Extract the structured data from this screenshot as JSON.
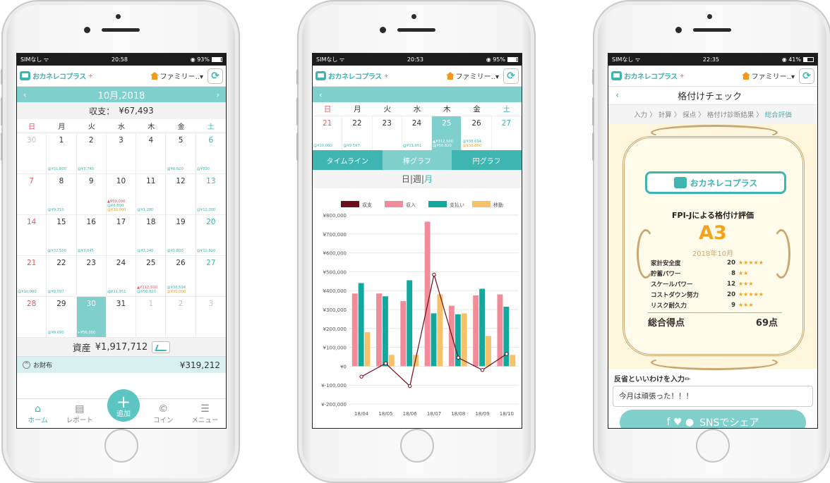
{
  "status": {
    "p1": {
      "carrier": "SIMなし ᯤ",
      "time": "20:58",
      "battery": "◉ 93%",
      "fill": 0.93
    },
    "p2": {
      "carrier": "SIMなし ᯤ",
      "time": "20:53",
      "battery": "◉ 95%",
      "fill": 0.95
    },
    "p3": {
      "carrier": "SIMなし ᯤ",
      "time": "22:35",
      "battery": "◉ 41%",
      "fill": 0.41
    }
  },
  "app": {
    "logo": "おカネレコプラス",
    "logo_sup": "+",
    "family": "ファミリー..▾",
    "refresh": "⟳"
  },
  "p1": {
    "month": "10月,2018",
    "prev": "‹",
    "next": "›",
    "balance_label": "収支：",
    "balance_value": "¥67,493",
    "dow": [
      "日",
      "月",
      "火",
      "水",
      "木",
      "金",
      "土"
    ],
    "days": [
      {
        "d": "30",
        "c": "gray",
        "l": []
      },
      {
        "d": "1",
        "c": "",
        "l": [
          [
            "ub",
            "@¥31,800"
          ]
        ]
      },
      {
        "d": "2",
        "c": "",
        "l": [
          [
            "ub",
            "@¥3,740"
          ]
        ]
      },
      {
        "d": "3",
        "c": "",
        "l": []
      },
      {
        "d": "4",
        "c": "",
        "l": []
      },
      {
        "d": "5",
        "c": "",
        "l": [
          [
            "ub",
            "@¥8,620"
          ]
        ]
      },
      {
        "d": "6",
        "c": "sat",
        "l": [
          [
            "ub",
            "@¥890"
          ]
        ]
      },
      {
        "d": "7",
        "c": "sun",
        "l": []
      },
      {
        "d": "8",
        "c": "",
        "l": [
          [
            "ub",
            "@¥9,710"
          ]
        ]
      },
      {
        "d": "9",
        "c": "",
        "l": []
      },
      {
        "d": "10",
        "c": "",
        "l": [
          [
            "uo",
            "@¥30,000"
          ],
          [
            "ub",
            "@¥6,890"
          ],
          [
            "ur",
            "▲¥69,000"
          ]
        ]
      },
      {
        "d": "11",
        "c": "",
        "l": [
          [
            "ub",
            "@¥1,200"
          ]
        ]
      },
      {
        "d": "12",
        "c": "",
        "l": []
      },
      {
        "d": "13",
        "c": "sat",
        "l": [
          [
            "ub",
            "@¥12,000"
          ]
        ]
      },
      {
        "d": "14",
        "c": "sun",
        "l": []
      },
      {
        "d": "15",
        "c": "",
        "l": [
          [
            "ub",
            "@¥32,500"
          ]
        ]
      },
      {
        "d": "16",
        "c": "",
        "l": [
          [
            "ub",
            "@¥3,045"
          ]
        ]
      },
      {
        "d": "17",
        "c": "",
        "l": []
      },
      {
        "d": "18",
        "c": "",
        "l": [
          [
            "ub",
            "@¥3,240"
          ]
        ]
      },
      {
        "d": "19",
        "c": "",
        "l": [
          [
            "ub",
            "@¥1,800"
          ]
        ]
      },
      {
        "d": "20",
        "c": "sat",
        "l": [
          [
            "ub",
            "@¥12,820"
          ]
        ]
      },
      {
        "d": "21",
        "c": "sun",
        "l": [
          [
            "ub",
            "@¥10,000"
          ]
        ]
      },
      {
        "d": "22",
        "c": "",
        "l": [
          [
            "ub",
            "@¥9,597"
          ]
        ]
      },
      {
        "d": "23",
        "c": "",
        "l": []
      },
      {
        "d": "24",
        "c": "",
        "l": [
          [
            "ub",
            "@¥11,951"
          ]
        ]
      },
      {
        "d": "25",
        "c": "",
        "l": [
          [
            "ub",
            "@¥50,820"
          ],
          [
            "ur",
            "▲¥312,500"
          ]
        ]
      },
      {
        "d": "26",
        "c": "",
        "l": [
          [
            "uo",
            "@¥30,000"
          ],
          [
            "ub",
            "@¥38,694"
          ]
        ]
      },
      {
        "d": "27",
        "c": "sat",
        "l": []
      },
      {
        "d": "28",
        "c": "sun",
        "l": []
      },
      {
        "d": "29",
        "c": "",
        "l": [
          [
            "ub",
            "@¥8,690"
          ]
        ]
      },
      {
        "d": "30",
        "c": "sel",
        "l": [
          [
            "w",
            "+¥56,000"
          ]
        ]
      },
      {
        "d": "31",
        "c": "",
        "l": []
      },
      {
        "d": "1",
        "c": "gray",
        "l": []
      },
      {
        "d": "2",
        "c": "gray",
        "l": []
      },
      {
        "d": "3",
        "c": "gray",
        "l": []
      }
    ],
    "asset_label": "資産",
    "asset_value": "¥1,917,712",
    "wallet_label": "お財布",
    "wallet_toggle": "^",
    "wallet_value": "¥319,212",
    "tabs": [
      {
        "icon": "⌂",
        "label": "ホーム"
      },
      {
        "icon": "▤",
        "label": "レポート"
      },
      {
        "icon": "",
        "label": ""
      },
      {
        "icon": "©",
        "label": "コイン"
      },
      {
        "icon": "☰",
        "label": "メニュー"
      }
    ],
    "add_label": "追加",
    "add_icon": "+"
  },
  "p2": {
    "prev": "‹",
    "dow": [
      "日",
      "月",
      "火",
      "水",
      "木",
      "金",
      "土"
    ],
    "days": [
      {
        "d": "21",
        "c": "sun",
        "l": [
          [
            "ub",
            "@¥10,000"
          ]
        ]
      },
      {
        "d": "22",
        "c": "",
        "l": [
          [
            "ub",
            "@¥9,597"
          ]
        ]
      },
      {
        "d": "23",
        "c": "",
        "l": []
      },
      {
        "d": "24",
        "c": "",
        "l": [
          [
            "ub",
            "@¥11,951"
          ]
        ]
      },
      {
        "d": "25",
        "c": "sel",
        "l": [
          [
            "w",
            "@¥50,820"
          ],
          [
            "w",
            "▲¥312,500"
          ]
        ]
      },
      {
        "d": "26",
        "c": "",
        "l": [
          [
            "uo",
            "@¥30,000"
          ],
          [
            "ub",
            "@¥38,694"
          ]
        ]
      },
      {
        "d": "27",
        "c": "sat",
        "l": []
      }
    ],
    "tabs": [
      "タイムライン",
      "棒グラフ",
      "円グラフ"
    ],
    "period": {
      "day": "日",
      "sep": "|",
      "week": "週",
      "sep2": "|",
      "month": "月"
    }
  },
  "chart_data": {
    "type": "bar",
    "categories": [
      "18/04",
      "18/05",
      "18/06",
      "18/07",
      "18/08",
      "18/09",
      "18/10"
    ],
    "series": [
      {
        "name": "収支",
        "kind": "line",
        "color": "#6b0f1a",
        "values": [
          -55000,
          15000,
          -105000,
          485000,
          45000,
          -20000,
          65000
        ]
      },
      {
        "name": "収入",
        "kind": "bar",
        "color": "#f28b99",
        "values": [
          385000,
          385000,
          345000,
          765000,
          320000,
          375000,
          380000
        ]
      },
      {
        "name": "支払い",
        "kind": "bar",
        "color": "#13a89e",
        "values": [
          440000,
          370000,
          455000,
          280000,
          275000,
          410000,
          315000
        ]
      },
      {
        "name": "移動",
        "kind": "bar",
        "color": "#f5c26b",
        "values": [
          180000,
          60000,
          60000,
          380000,
          280000,
          160000,
          60000
        ]
      }
    ],
    "yticks": [
      "¥800,000",
      "¥700,000",
      "¥600,000",
      "¥500,000",
      "¥400,000",
      "¥300,000",
      "¥200,000",
      "¥100,000",
      "¥0",
      "¥-100,000",
      "¥-200,000"
    ],
    "ylim": [
      -200000,
      800000
    ],
    "legend": "top",
    "grid": true
  },
  "p3": {
    "back": "‹",
    "title": "格付けチェック",
    "crumbs": [
      "入力",
      "計算",
      "採点",
      "格付け診断結果",
      "総合評価"
    ],
    "crumb_sep": "〉",
    "cert_logo": "おカネレコプラス",
    "cert_title": "FPI-Jによる格付け評価",
    "grade": "A3",
    "date": "2018年10月",
    "scores": [
      {
        "label": "家計安全度",
        "value": "20",
        "stars": "★★★★★"
      },
      {
        "label": "貯蓄パワー",
        "value": "8",
        "stars": "★★"
      },
      {
        "label": "スケールパワー",
        "value": "12",
        "stars": "★★★"
      },
      {
        "label": "コストダウン努力",
        "value": "20",
        "stars": "★★★★★"
      },
      {
        "label": "リスク耐久力",
        "value": "9",
        "stars": "★★★"
      }
    ],
    "total_label": "総合得点",
    "total_value": "69点",
    "reflect_label": "反省といいわけを入力✏",
    "reflect_value": "今月は頑張った！！！",
    "share": "SNSでシェア",
    "share_icons": "f ♥ ●"
  },
  "colors": {
    "teal": "#3fb5b1",
    "teal_light": "#7fcfcc",
    "red": "#e05a63",
    "orange": "#f29a1b",
    "gold": "#c8a870"
  }
}
